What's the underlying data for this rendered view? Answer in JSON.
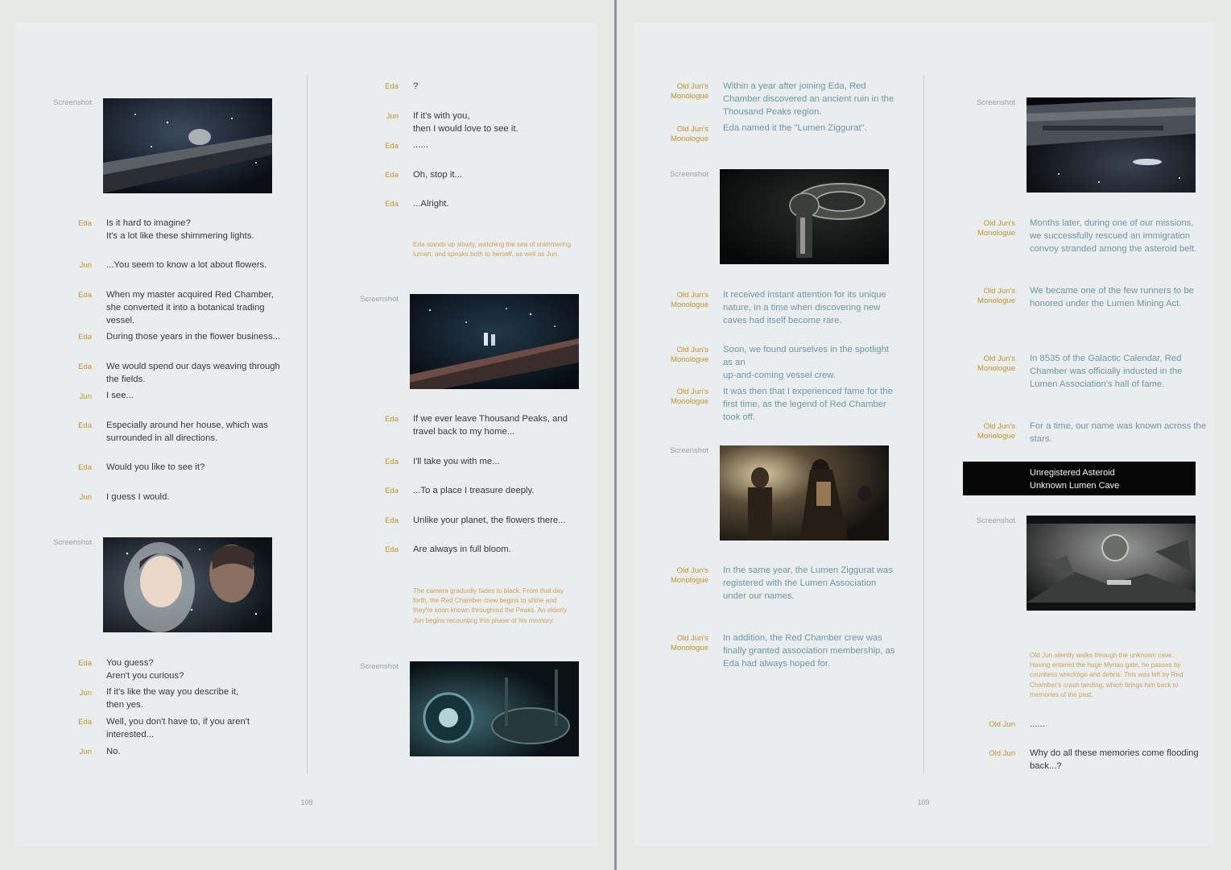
{
  "pages": {
    "left_number": "108",
    "right_number": "109"
  },
  "screenshot_label": "Screenshot",
  "left_col1": [
    {
      "speaker": "Eda",
      "text": "Is it hard to imagine?\nIt's a lot like these shimmering lights."
    },
    {
      "speaker": "Jun",
      "text": "...You seem to know a lot about flowers."
    },
    {
      "speaker": "Eda",
      "text": "When my master acquired Red Chamber,\nshe converted it into a botanical trading\nvessel."
    },
    {
      "speaker": "Eda",
      "text": "During those years in the flower business..."
    },
    {
      "speaker": "Eda",
      "text": "We would spend our days weaving through\nthe fields."
    },
    {
      "speaker": "Jun",
      "text": "I see..."
    },
    {
      "speaker": "Eda",
      "text": "Especially around her house, which was\nsurrounded in all directions."
    },
    {
      "speaker": "Eda",
      "text": "Would you like to see it?"
    },
    {
      "speaker": "Jun",
      "text": "I guess I would."
    },
    {
      "speaker": "Eda",
      "text": "You guess?\nAren't you curious?"
    },
    {
      "speaker": "Jun",
      "text": "If it's like the way you describe it,\nthen yes."
    },
    {
      "speaker": "Eda",
      "text": "Well, you don't have to, if you aren't\ninterested..."
    },
    {
      "speaker": "Jun",
      "text": "No."
    }
  ],
  "left_col2": [
    {
      "speaker": "Eda",
      "text": "?"
    },
    {
      "speaker": "Jun",
      "text": "If it's with you,\nthen I would love to see it."
    },
    {
      "speaker": "Eda",
      "text": "......"
    },
    {
      "speaker": "Eda",
      "text": "Oh, stop it..."
    },
    {
      "speaker": "Eda",
      "text": "...Alright."
    },
    {
      "speaker": "Eda",
      "text": "If we ever leave Thousand Peaks, and\ntravel back to my home..."
    },
    {
      "speaker": "Eda",
      "text": "I'll take you with me..."
    },
    {
      "speaker": "Eda",
      "text": "...To a place I treasure deeply."
    },
    {
      "speaker": "Eda",
      "text": "Unlike your planet, the flowers there..."
    },
    {
      "speaker": "Eda",
      "text": "Are always in full bloom."
    }
  ],
  "left_notes": [
    "Eda stands up slowly, watching the sea of shimmering\nlumen, and speaks both to herself, as well as Jun.",
    "The camera gradually fades to black. From that day\nforth, the Red Chamber crew begins to shine and\nthey're soon known throughout the Peaks. An elderly\nJun begins recounting this phase of his memory."
  ],
  "right_col1": [
    {
      "speaker": "Old Jun's\nMonologue",
      "text": "Within a year after joining Eda, Red\nChamber discovered an ancient ruin in the\nThousand Peaks region."
    },
    {
      "speaker": "Old Jun's\nMonologue",
      "text": "Eda named it the \"Lumen Ziggurat\"."
    },
    {
      "speaker": "Old Jun's\nMonologue",
      "text": "It received instant attention for its unique\nnature, in a time when discovering new\ncaves had itself become rare."
    },
    {
      "speaker": "Old Jun's\nMonologue",
      "text": "Soon, we found ourselves in the spotlight\nas an\nup-and-coming vessel crew."
    },
    {
      "speaker": "Old Jun's\nMonologue",
      "text": "It was then that I experienced fame for the\nfirst time, as the legend of Red Chamber\ntook off."
    },
    {
      "speaker": "Old Jun's\nMonologue",
      "text": "In the same year, the Lumen Ziggurat was\nregistered with the Lumen Association\nunder our names."
    },
    {
      "speaker": "Old Jun's\nMonologue",
      "text": "In addition, the Red Chamber crew was\nfinally granted association membership, as\nEda had always hoped for."
    }
  ],
  "right_col2": [
    {
      "speaker": "Old Jun's\nMonologue",
      "text": "Months later, during one of our missions,\nwe successfully rescued an immigration\nconvoy stranded among the asteroid belt."
    },
    {
      "speaker": "Old Jun's\nMonologue",
      "text": "We became one of the few runners to be\nhonored under the Lumen Mining Act."
    },
    {
      "speaker": "Old Jun's\nMonologue",
      "text": "In 8535 of the Galactic Calendar, Red\nChamber was officially inducted in the\nLumen Association's hall of fame."
    },
    {
      "speaker": "Old Jun's\nMonologue",
      "text": "For a time, our name was known across the\nstars."
    },
    {
      "speaker": "Old Jun",
      "text": "......"
    },
    {
      "speaker": "Old Jun",
      "text": "Why do all these memories come flooding\nback...?"
    }
  ],
  "right_note": "Old Jun silently walks through the unknown cave.\nHaving entered the huge Myrian gate, he passes by\ncountless wreckage and debris. This was left by Red\nChamber's crash landing, which brings him back to\nmemories of the past.",
  "location_banner": {
    "line1": "Unregistered Asteroid",
    "line2": "Unknown Lumen Cave"
  }
}
